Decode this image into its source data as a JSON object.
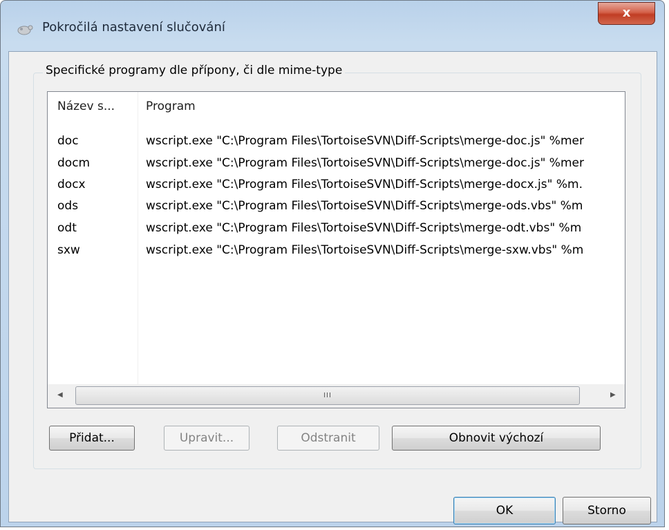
{
  "window": {
    "title": "Pokročilá nastavení slučování",
    "close_label": "x"
  },
  "group": {
    "label": "Specifické programy dle přípony, či dle mime-type"
  },
  "list": {
    "columns": [
      "Název s...",
      "Program"
    ],
    "rows": [
      {
        "name": "doc",
        "program": "wscript.exe \"C:\\Program Files\\TortoiseSVN\\Diff-Scripts\\merge-doc.js\" %mer"
      },
      {
        "name": "docm",
        "program": "wscript.exe \"C:\\Program Files\\TortoiseSVN\\Diff-Scripts\\merge-doc.js\" %mer"
      },
      {
        "name": "docx",
        "program": "wscript.exe \"C:\\Program Files\\TortoiseSVN\\Diff-Scripts\\merge-docx.js\" %m."
      },
      {
        "name": "ods",
        "program": "wscript.exe \"C:\\Program Files\\TortoiseSVN\\Diff-Scripts\\merge-ods.vbs\" %m"
      },
      {
        "name": "odt",
        "program": "wscript.exe \"C:\\Program Files\\TortoiseSVN\\Diff-Scripts\\merge-odt.vbs\" %m"
      },
      {
        "name": "sxw",
        "program": "wscript.exe \"C:\\Program Files\\TortoiseSVN\\Diff-Scripts\\merge-sxw.vbs\" %m"
      }
    ],
    "scroll_grip": "III"
  },
  "buttons": {
    "add": "Přidat...",
    "edit": "Upravit...",
    "remove": "Odstranit",
    "restore": "Obnovit výchozí",
    "ok": "OK",
    "cancel": "Storno"
  }
}
